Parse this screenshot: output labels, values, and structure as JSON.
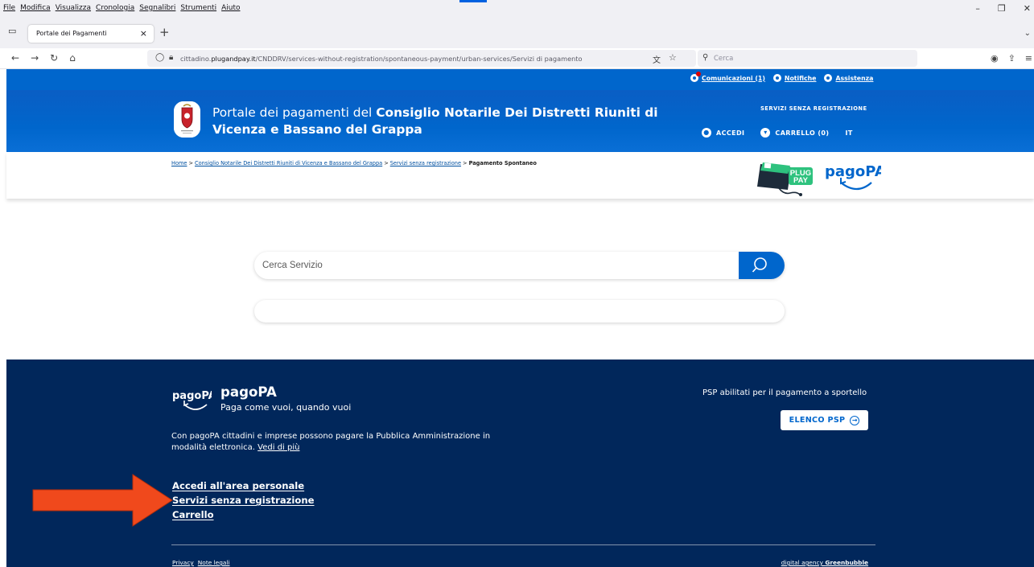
{
  "browser": {
    "menu": [
      "File",
      "Modifica",
      "Visualizza",
      "Cronologia",
      "Segnalibri",
      "Strumenti",
      "Aiuto"
    ],
    "tab_title": "Portale dei Pagamenti",
    "url_prefix": "cittadino.",
    "url_domain": "plugandpay.it",
    "url_path": "/CNDDRV/services-without-registration/spontaneous-payment/urban-services/Servizi di pagamento",
    "search_placeholder": "Cerca"
  },
  "utility": {
    "comunicazioni": "Comunicazioni (1)",
    "notifiche": "Notifiche",
    "assistenza": "Assistenza"
  },
  "header": {
    "title_prefix": "Portale dei pagamenti del ",
    "title_bold": "Consiglio Notarile Dei Distretti Riuniti di Vicenza e Bassano del Grappa",
    "services_label": "SERVIZI SENZA REGISTRAZIONE",
    "login": "ACCEDI",
    "cart": "CARRELLO (0)",
    "lang": "IT"
  },
  "breadcrumb": {
    "home": "Home",
    "ente": "Consiglio Notarile Dei Distretti Riuniti di Vicenza e Bassano del Grappa",
    "servizi": "Servizi senza registrazione",
    "current": "Pagamento Spontaneo",
    "sep": ">"
  },
  "logos": {
    "plug": "PLUG",
    "pay": "PAY",
    "pagopa": "pagoPA"
  },
  "search": {
    "placeholder": "Cerca Servizio"
  },
  "footer": {
    "title": "pagoPA",
    "subtitle": "Paga come vuoi, quando vuoi",
    "description": "Con pagoPA cittadini e imprese possono pagare la Pubblica Amministrazione in modalità elettronica.",
    "more_link": "Vedi di più",
    "psp_text": "PSP abilitati per il pagamento a sportello",
    "psp_button": "ELENCO PSP",
    "links": [
      "Accedi all'area personale",
      "Servizi senza registrazione",
      "Carrello"
    ],
    "privacy": "Privacy",
    "legal": "Note legali",
    "agency_prefix": "digital agency ",
    "agency_name": "Greenbubble"
  },
  "colors": {
    "brand_blue": "#0066cc",
    "footer_navy": "#01275b",
    "arrow_orange": "#f0491c"
  }
}
